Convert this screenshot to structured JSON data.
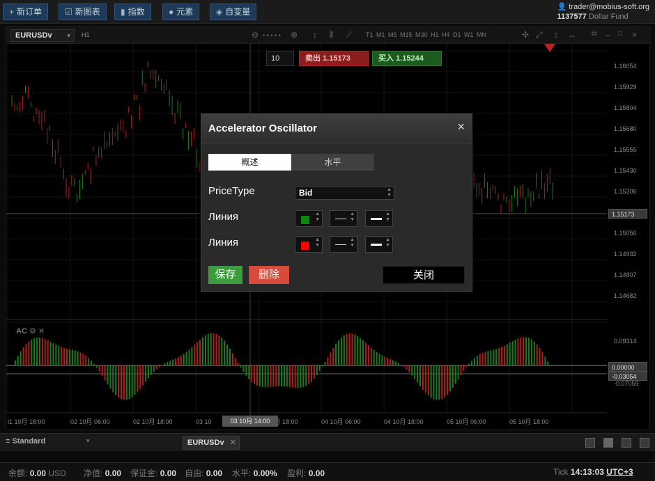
{
  "toolbar": {
    "new_order": "新订单",
    "new_chart": "新图表",
    "indicators": "指数",
    "elements": "元素",
    "variables": "自变量"
  },
  "account": {
    "email": "trader@mobius-soft.org",
    "id": "1137577",
    "fund": "Dollar Fund"
  },
  "chart": {
    "symbol": "EURUSDv",
    "period": "H1",
    "timeframes": "T1 M1 M5 M15 M30 H1 H4 D1 W1 MN",
    "quantity": "10",
    "sell_label": "卖出 1.15173",
    "buy_label": "买入 1.15244",
    "current_price_tag": "1.15173",
    "price_axis": [
      "1.16054",
      "1.15929",
      "1.15804",
      "1.15680",
      "1.15555",
      "1.15430",
      "1.15306",
      "1.15056",
      "1.14932",
      "1.14807",
      "1.14682"
    ],
    "indicator_label": "AC",
    "indicator_axis": [
      "0.09314",
      "-0.07059"
    ],
    "indicator_tag_zero": "0.00000",
    "indicator_tag_value": "-0.03054",
    "time_axis": [
      "l1 10月 18:00",
      "02 10月 06:00",
      "02 10月 18:00",
      "03 10",
      "03 10月 18:00",
      "04 10月 06:00",
      "04 10月 18:00",
      "05 10月 06:00",
      "05 10月 18:00"
    ],
    "time_cursor": "03 10月 14:00",
    "colors": {
      "up": "#1e7a1e",
      "down": "#b01e1e",
      "sell": "#8b1d1d",
      "buy": "#1d5a1d"
    }
  },
  "modal": {
    "title": "Accelerator Oscillator",
    "close_glyph": "×",
    "tab_overview": "概述",
    "tab_levels": "水平",
    "price_type_label": "PriceType",
    "price_type_value": "Bid",
    "line1_label": "Линия",
    "line1_color": "#0a8a0a",
    "line2_label": "Линия",
    "line2_color": "#ff0000",
    "save": "保存",
    "delete": "删除",
    "close": "关闭"
  },
  "bottom": {
    "workspace": "Standard",
    "tab": "EURUSDv"
  },
  "status": {
    "balance_label": "余额:",
    "balance": "0.00",
    "balance_ccy": "USD",
    "equity_label": "净值:",
    "equity": "0.00",
    "margin_label": "保证金:",
    "margin": "0.00",
    "free_label": "自由:",
    "free": "0.00",
    "level_label": "水平:",
    "level": "0.00%",
    "profit_label": "盈利:",
    "profit": "0.00",
    "tick_label": "Tick",
    "time": "14:13:03",
    "tz": "UTC+3"
  }
}
